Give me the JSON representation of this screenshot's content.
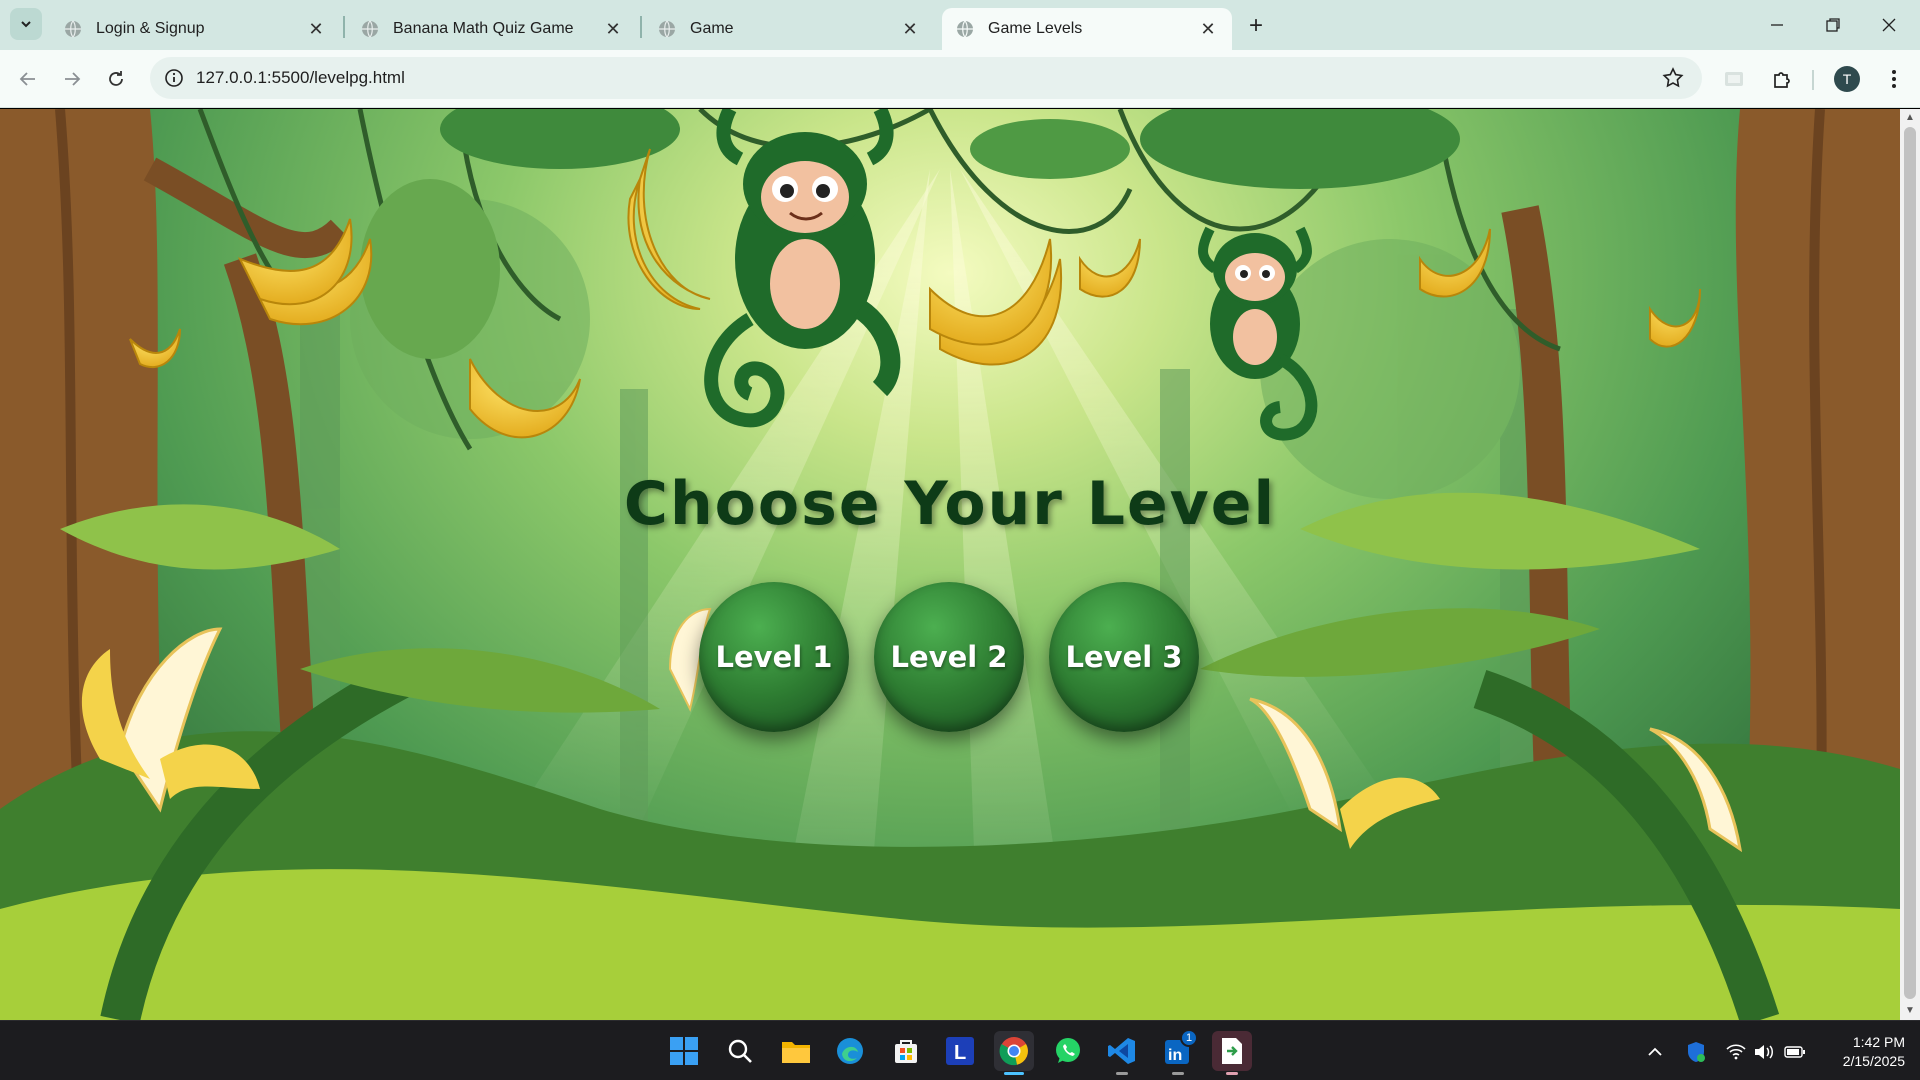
{
  "browser": {
    "tabs": [
      {
        "title": "Login & Signup",
        "active": false
      },
      {
        "title": "Banana Math Quiz Game",
        "active": false
      },
      {
        "title": "Game",
        "active": false
      },
      {
        "title": "Game Levels",
        "active": true
      }
    ],
    "url": "127.0.0.1:5500/levelpg.html",
    "profile_initial": "T"
  },
  "page": {
    "heading": "Choose Your Level",
    "levels": [
      "Level 1",
      "Level 2",
      "Level 3"
    ]
  },
  "taskbar": {
    "apps": [
      "start-icon",
      "search-icon",
      "file-explorer-icon",
      "edge-icon",
      "store-icon",
      "l-app-icon",
      "chrome-icon",
      "whatsapp-icon",
      "vscode-icon",
      "linkedin-icon",
      "terminal-app-icon"
    ],
    "linkedin_badge": "1",
    "time": "1:42 PM",
    "date": "2/15/2025"
  },
  "colors": {
    "accent": "#2e7d32",
    "heading": "#0e3b17",
    "banana": "#f4c430"
  }
}
